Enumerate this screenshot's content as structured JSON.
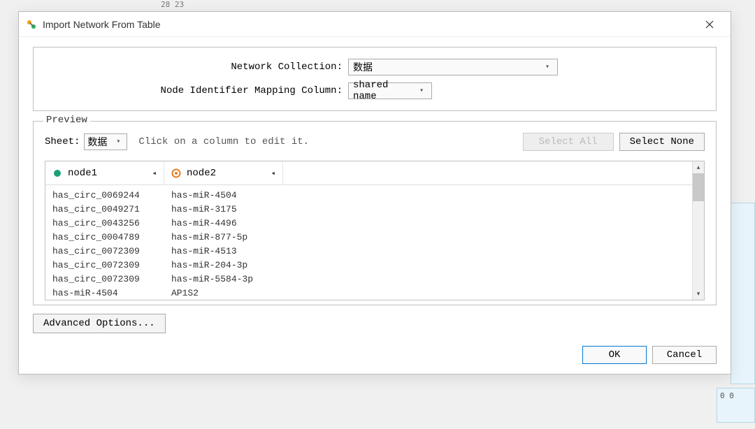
{
  "bg": {
    "topText": "28 23",
    "edgeNums": "0\n0"
  },
  "dialog": {
    "title": "Import Network From Table",
    "form": {
      "networkCollectionLabel": "Network Collection:",
      "networkCollectionValue": "数据",
      "mappingLabel": "Node Identifier Mapping Column:",
      "mappingValue": "shared name"
    },
    "preview": {
      "legend": "Preview",
      "sheetLabel": "Sheet:",
      "sheetValue": "数据",
      "hint": "Click on a column to edit it.",
      "selectAll": "Select All",
      "selectNone": "Select None",
      "columns": {
        "c1": "node1",
        "c2": "node2"
      },
      "rows": [
        {
          "a": "has_circ_0069244",
          "b": "has-miR-4504"
        },
        {
          "a": "has_circ_0049271",
          "b": "has-miR-3175"
        },
        {
          "a": "has_circ_0043256",
          "b": "has-miR-4496"
        },
        {
          "a": "has_circ_0004789",
          "b": "has-miR-877-5p"
        },
        {
          "a": "has_circ_0072309",
          "b": "has-miR-4513"
        },
        {
          "a": "has_circ_0072309",
          "b": "has-miR-204-3p"
        },
        {
          "a": "has_circ_0072309",
          "b": "has-miR-5584-3p"
        },
        {
          "a": "has-miR-4504",
          "b": "AP1S2"
        }
      ]
    },
    "advanced": "Advanced Options...",
    "ok": "OK",
    "cancel": "Cancel"
  }
}
